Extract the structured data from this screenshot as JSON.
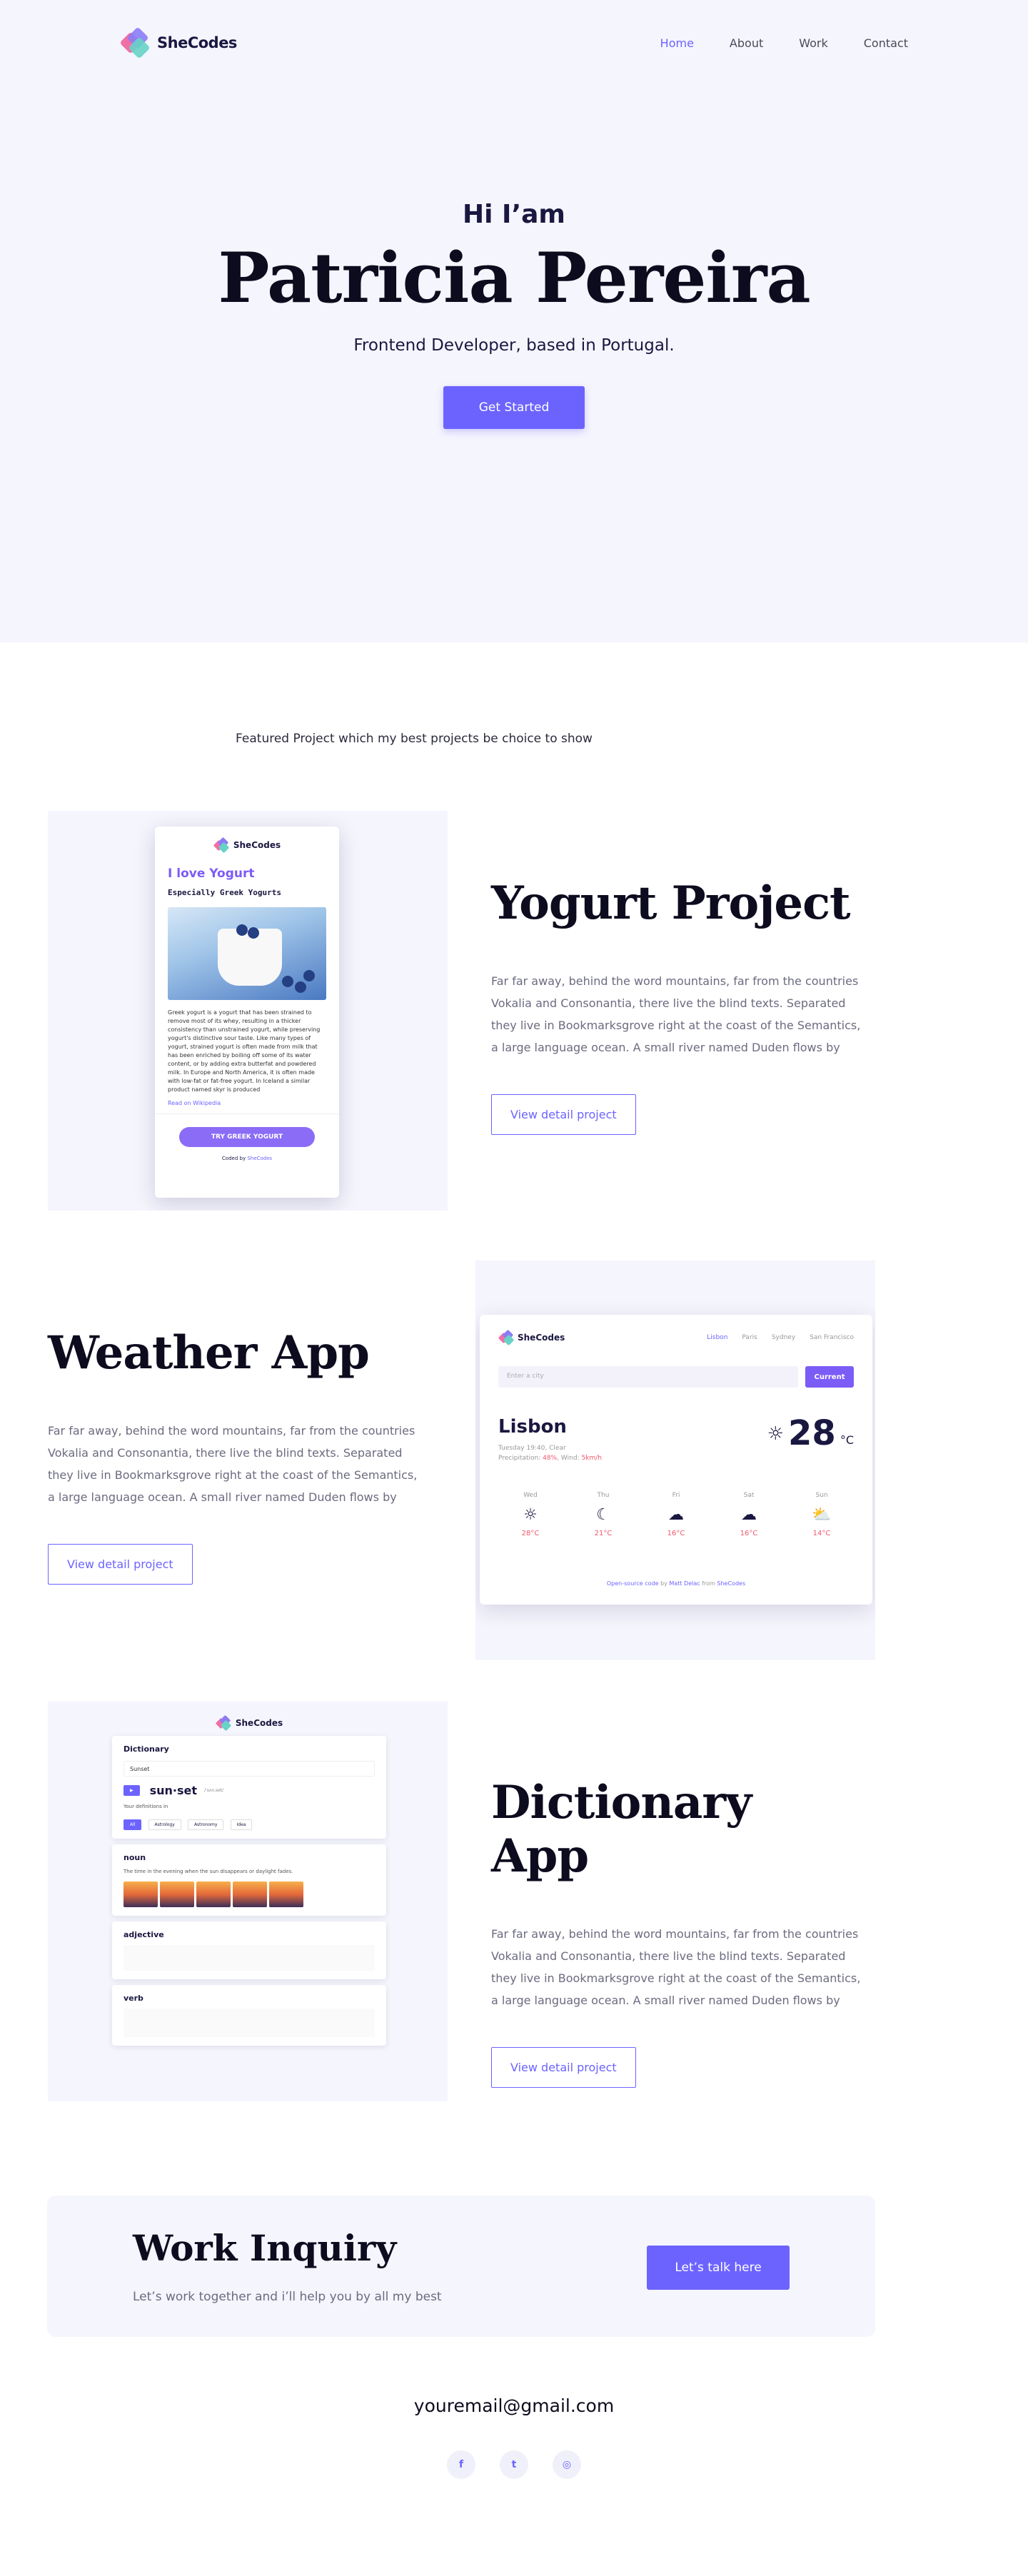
{
  "nav": {
    "logo_text": "SheCodes",
    "links": [
      "Home",
      "About",
      "Work",
      "Contact"
    ]
  },
  "hero": {
    "greeting": "Hi I’am",
    "name": "Patricia Pereira",
    "role": "Frontend Developer, based in Portugal.",
    "cta": "Get Started"
  },
  "featured_caption": "Featured Project which my best projects be choice to show",
  "projects": [
    {
      "title": "Yogurt Project",
      "desc": "Far far away, behind the word mountains, far from the countries Vokalia and Consonantia, there live the blind texts. Separated they live in Bookmarksgrove right at the coast of the Semantics, a large language ocean. A small river named Duden flows by",
      "button": "View detail project"
    },
    {
      "title": "Weather App",
      "desc": "Far far away, behind the word mountains, far from the countries Vokalia and Consonantia, there live the blind texts. Separated they live in Bookmarksgrove right at the coast of the Semantics, a large language ocean. A small river named Duden flows by",
      "button": "View detail project"
    },
    {
      "title": "Dictionary App",
      "desc": "Far far away, behind the word mountains, far from the countries Vokalia and Consonantia, there live the blind texts. Separated they live in Bookmarksgrove right at the coast of the Semantics, a large language ocean. A small river named Duden flows by",
      "button": "View detail project"
    }
  ],
  "yogurt_mock": {
    "logo": "SheCodes",
    "heading": "I love Yogurt",
    "subheading": "Especially Greek Yogurts",
    "body": "Greek yogurt is a yogurt that has been strained to remove most of its whey, resulting in a thicker consistency than unstrained yogurt, while preserving yogurt's distinctive sour taste. Like many types of yogurt, strained yogurt is often made from milk that has been enriched by boiling off some of its water content, or by adding extra butterfat and powdered milk. In Europe and North America, it is often made with low-fat or fat-free yogurt. In Iceland a similar product named skyr is produced",
    "link": "Read on Wikipedia",
    "button": "TRY GREEK YOGURT",
    "footer_prefix": "Coded by",
    "footer_brand": "SheCodes"
  },
  "weather_mock": {
    "logo": "SheCodes",
    "cities": [
      "Lisbon",
      "Paris",
      "Sydney",
      "San Francisco"
    ],
    "search_placeholder": "Enter a city",
    "current_button": "Current",
    "city": "Lisbon",
    "meta_line1": "Tuesday 19:40, Clear",
    "meta_precip_label": "Precipitation:",
    "meta_precip": "48%",
    "meta_wind_label": "Wind:",
    "meta_wind": "5km/h",
    "temp": "28",
    "unit": "°C",
    "forecast": [
      {
        "day": "Wed",
        "icon": "☼",
        "temp": "28°C"
      },
      {
        "day": "Thu",
        "icon": "☾",
        "temp": "21°C"
      },
      {
        "day": "Fri",
        "icon": "☁",
        "temp": "16°C"
      },
      {
        "day": "Sat",
        "icon": "☁",
        "temp": "16°C"
      },
      {
        "day": "Sun",
        "icon": "⛅",
        "temp": "14°C"
      }
    ],
    "footer_link": "Open-source code",
    "footer_by": "by",
    "footer_author": "Matt Delac",
    "footer_from": "from",
    "footer_brand": "SheCodes"
  },
  "dictionary_mock": {
    "logo": "SheCodes",
    "title": "Dictionary",
    "search_value": "Sunset",
    "word": "sun·set",
    "phonetic": "/ˈsʌnˌset/",
    "synonyms_label": "Your definitions in",
    "pills": [
      "All",
      "Astrology",
      "Astronomy",
      "Idea"
    ],
    "noun_label": "noun",
    "noun_def": "The time in the evening when the sun disappears or daylight fades.",
    "adjective_label": "adjective",
    "verb_label": "verb"
  },
  "inquiry": {
    "title": "Work Inquiry",
    "subtitle": "Let’s work  together and i’ll help you by all my best",
    "button": "Let’s talk here"
  },
  "footer": {
    "email": "youremail@gmail.com",
    "socials": [
      "f",
      "t",
      "◎"
    ]
  }
}
